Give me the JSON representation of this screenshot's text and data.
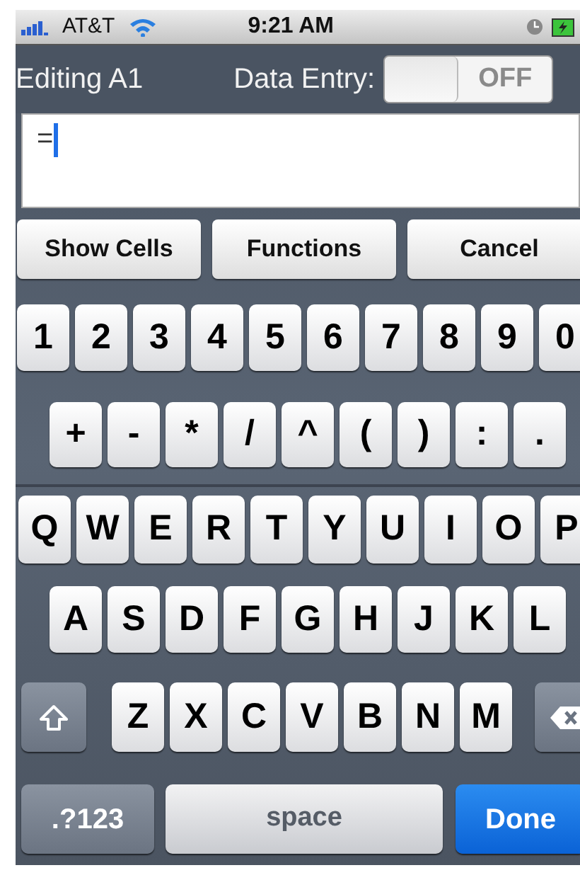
{
  "status_bar": {
    "carrier": "AT&T",
    "time": "9:21 AM"
  },
  "header": {
    "title": "Editing A1",
    "toggle": {
      "label": "Data Entry:",
      "on": false,
      "text": "OFF"
    }
  },
  "formula_field": {
    "value": "="
  },
  "actions": [
    "Show Cells",
    "Functions",
    "Cancel"
  ],
  "keyboard": {
    "rows": [
      {
        "keys": [
          {
            "kind": "char",
            "label": "1"
          },
          {
            "kind": "char",
            "label": "2"
          },
          {
            "kind": "char",
            "label": "3"
          },
          {
            "kind": "char",
            "label": "4"
          },
          {
            "kind": "char",
            "label": "5"
          },
          {
            "kind": "char",
            "label": "6"
          },
          {
            "kind": "char",
            "label": "7"
          },
          {
            "kind": "char",
            "label": "8"
          },
          {
            "kind": "char",
            "label": "9"
          },
          {
            "kind": "char",
            "label": "0"
          }
        ]
      },
      {
        "keys": [
          {
            "kind": "char",
            "label": "+"
          },
          {
            "kind": "char",
            "label": "-"
          },
          {
            "kind": "char",
            "label": "*"
          },
          {
            "kind": "char",
            "label": "/"
          },
          {
            "kind": "char",
            "label": "^"
          },
          {
            "kind": "char",
            "label": "("
          },
          {
            "kind": "char",
            "label": ")"
          },
          {
            "kind": "char",
            "label": ":"
          },
          {
            "kind": "char",
            "label": "."
          }
        ]
      },
      {
        "keys": [
          {
            "kind": "char",
            "label": "Q"
          },
          {
            "kind": "char",
            "label": "W"
          },
          {
            "kind": "char",
            "label": "E"
          },
          {
            "kind": "char",
            "label": "R"
          },
          {
            "kind": "char",
            "label": "T"
          },
          {
            "kind": "char",
            "label": "Y"
          },
          {
            "kind": "char",
            "label": "U"
          },
          {
            "kind": "char",
            "label": "I"
          },
          {
            "kind": "char",
            "label": "O"
          },
          {
            "kind": "char",
            "label": "P"
          }
        ]
      },
      {
        "keys": [
          {
            "kind": "char",
            "label": "A"
          },
          {
            "kind": "char",
            "label": "S"
          },
          {
            "kind": "char",
            "label": "D"
          },
          {
            "kind": "char",
            "label": "F"
          },
          {
            "kind": "char",
            "label": "G"
          },
          {
            "kind": "char",
            "label": "H"
          },
          {
            "kind": "char",
            "label": "J"
          },
          {
            "kind": "char",
            "label": "K"
          },
          {
            "kind": "char",
            "label": "L"
          }
        ]
      },
      {
        "keys": [
          {
            "kind": "shift"
          },
          {
            "kind": "char",
            "label": "Z"
          },
          {
            "kind": "char",
            "label": "X"
          },
          {
            "kind": "char",
            "label": "C"
          },
          {
            "kind": "char",
            "label": "V"
          },
          {
            "kind": "char",
            "label": "B"
          },
          {
            "kind": "char",
            "label": "N"
          },
          {
            "kind": "char",
            "label": "M"
          },
          {
            "kind": "backspace"
          }
        ]
      },
      {
        "keys": [
          {
            "kind": "mode",
            "label": ".?123"
          },
          {
            "kind": "space",
            "label": "space"
          },
          {
            "kind": "done",
            "label": "Done"
          }
        ]
      }
    ]
  }
}
